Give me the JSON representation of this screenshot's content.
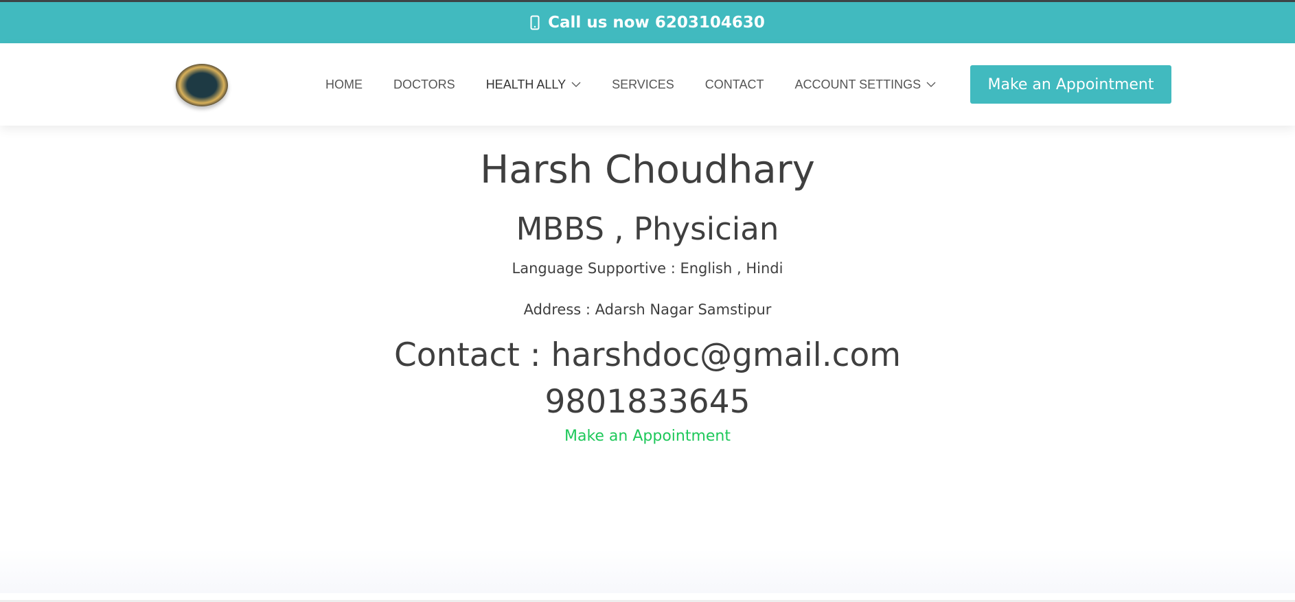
{
  "topbar": {
    "text": "Call us now 6203104630",
    "icon": "mobile-phone-icon"
  },
  "nav": {
    "items": [
      {
        "label": "HOME"
      },
      {
        "label": "DOCTORS"
      },
      {
        "label": "HEALTH ALLY",
        "dropdown": true
      },
      {
        "label": "SERVICES"
      },
      {
        "label": "CONTACT"
      },
      {
        "label": "ACCOUNT SETTINGS",
        "dropdown": true
      }
    ],
    "cta": "Make an Appointment"
  },
  "doctor": {
    "name": "Harsh Choudhary",
    "qualification": "MBBS , Physician",
    "languages": "Language Supportive : English , Hindi",
    "address": "Address : Adarsh Nagar Samstipur",
    "contact": "Contact : harshdoc@gmail.com",
    "phone": "9801833645",
    "appointment_link": "Make an Appointment"
  },
  "colors": {
    "accent": "#41babf",
    "link": "#1ec85a",
    "text": "#3f3f3f"
  }
}
